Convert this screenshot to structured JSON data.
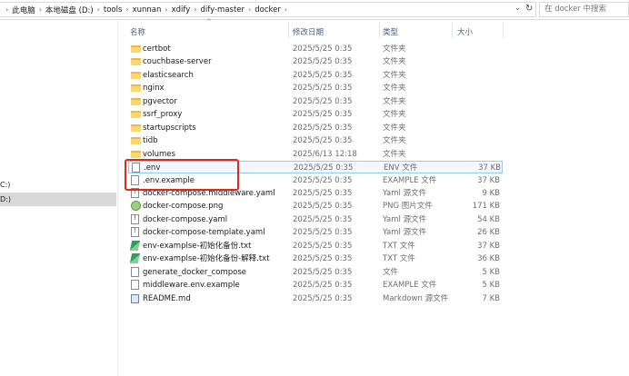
{
  "breadcrumb": [
    "此电脑",
    "本地磁盘 (D:)",
    "tools",
    "xunnan",
    "xdify",
    "dify-master",
    "docker"
  ],
  "search": {
    "placeholder": "在 docker 中搜索"
  },
  "nav": {
    "items": [
      {
        "label": "C:)"
      },
      {
        "label": "D:)"
      }
    ]
  },
  "columns": {
    "name": "名称",
    "date": "修改日期",
    "type": "类型",
    "size": "大小"
  },
  "files": [
    {
      "name": "certbot",
      "date": "2025/5/25 0:35",
      "type": "文件夹",
      "size": "",
      "icon": "folder-icon"
    },
    {
      "name": "couchbase-server",
      "date": "2025/5/25 0:35",
      "type": "文件夹",
      "size": "",
      "icon": "folder-icon"
    },
    {
      "name": "elasticsearch",
      "date": "2025/5/25 0:35",
      "type": "文件夹",
      "size": "",
      "icon": "folder-icon"
    },
    {
      "name": "nginx",
      "date": "2025/5/25 0:35",
      "type": "文件夹",
      "size": "",
      "icon": "folder-icon"
    },
    {
      "name": "pgvector",
      "date": "2025/5/25 0:35",
      "type": "文件夹",
      "size": "",
      "icon": "folder-icon"
    },
    {
      "name": "ssrf_proxy",
      "date": "2025/5/25 0:35",
      "type": "文件夹",
      "size": "",
      "icon": "folder-icon"
    },
    {
      "name": "startupscripts",
      "date": "2025/5/25 0:35",
      "type": "文件夹",
      "size": "",
      "icon": "folder-icon"
    },
    {
      "name": "tidb",
      "date": "2025/5/25 0:35",
      "type": "文件夹",
      "size": "",
      "icon": "folder-icon"
    },
    {
      "name": "volumes",
      "date": "2025/6/13 12:18",
      "type": "文件夹",
      "size": "",
      "icon": "folder-icon"
    },
    {
      "name": ".env",
      "date": "2025/5/25 0:35",
      "type": "ENV 文件",
      "size": "37 KB",
      "icon": "file-icon"
    },
    {
      "name": ".env.example",
      "date": "2025/5/25 0:35",
      "type": "EXAMPLE 文件",
      "size": "37 KB",
      "icon": "file-icon"
    },
    {
      "name": "docker-compose.middleware.yaml",
      "date": "2025/5/25 0:35",
      "type": "Yaml 源文件",
      "size": "9 KB",
      "icon": "yaml-file-icon"
    },
    {
      "name": "docker-compose.png",
      "date": "2025/5/25 0:35",
      "type": "PNG 图片文件",
      "size": "171 KB",
      "icon": "png-image-icon"
    },
    {
      "name": "docker-compose.yaml",
      "date": "2025/5/25 0:35",
      "type": "Yaml 源文件",
      "size": "54 KB",
      "icon": "yaml-file-icon"
    },
    {
      "name": "docker-compose-template.yaml",
      "date": "2025/5/25 0:35",
      "type": "Yaml 源文件",
      "size": "26 KB",
      "icon": "yaml-file-icon"
    },
    {
      "name": "env-examplse-初始化备份.txt",
      "date": "2025/5/25 0:35",
      "type": "TXT 文件",
      "size": "37 KB",
      "icon": "txt-file-icon"
    },
    {
      "name": "env-examplse-初始化备份-解释.txt",
      "date": "2025/5/25 0:35",
      "type": "TXT 文件",
      "size": "36 KB",
      "icon": "txt-file-icon"
    },
    {
      "name": "generate_docker_compose",
      "date": "2025/5/25 0:35",
      "type": "文件",
      "size": "5 KB",
      "icon": "file-icon"
    },
    {
      "name": "middleware.env.example",
      "date": "2025/5/25 0:35",
      "type": "EXAMPLE 文件",
      "size": "5 KB",
      "icon": "file-icon"
    },
    {
      "name": "README.md",
      "date": "2025/5/25 0:35",
      "type": "Markdown 源文件",
      "size": "7 KB",
      "icon": "markdown-file-icon"
    }
  ]
}
